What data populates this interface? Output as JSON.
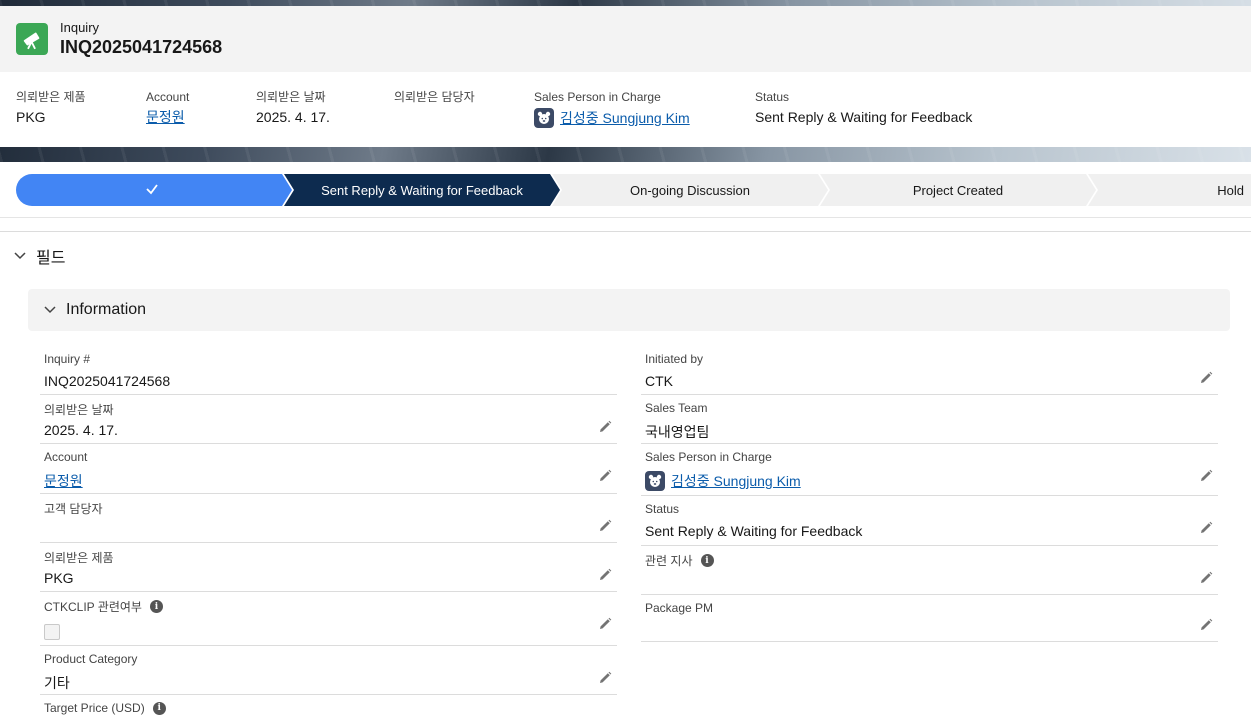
{
  "record": {
    "type_label": "Inquiry",
    "name": "INQ2025041724568",
    "icon": "telescope-icon",
    "icon_color": "#3ba755"
  },
  "highlights": [
    {
      "label": "의뢰받은 제품",
      "value": "PKG"
    },
    {
      "label": "Account",
      "value": "문정원"
    },
    {
      "label": "의뢰받은 날짜",
      "value": "2025. 4. 17."
    },
    {
      "label": "의뢰받은 담당자",
      "value": ""
    },
    {
      "label": "Sales Person in Charge",
      "value": "김성중 Sungjung Kim"
    },
    {
      "label": "Status",
      "value": "Sent Reply & Waiting for Feedback"
    }
  ],
  "path": {
    "steps": [
      {
        "label": "✓",
        "state": "complete"
      },
      {
        "label": "Sent Reply & Waiting for Feedback",
        "state": "current"
      },
      {
        "label": "On-going Discussion",
        "state": "incomplete"
      },
      {
        "label": "Project Created",
        "state": "incomplete"
      },
      {
        "label": "Hold",
        "state": "incomplete"
      }
    ],
    "colors": {
      "complete": "#4285f4",
      "current": "#0d2b4f",
      "incomplete": "#f0f0f0"
    }
  },
  "section": {
    "title": "필드",
    "subsection": "Information"
  },
  "left_fields": [
    {
      "label": "Inquiry #",
      "value": "INQ2025041724568"
    },
    {
      "label": "의뢰받은 날짜",
      "value": "2025. 4. 17."
    },
    {
      "label": "Account",
      "value": "문정원"
    },
    {
      "label": "고객 담당자",
      "value": ""
    },
    {
      "label": "의뢰받은 제품",
      "value": "PKG"
    },
    {
      "label": "CTKCLIP 관련여부",
      "value": ""
    },
    {
      "label": "Product Category",
      "value": "기타"
    },
    {
      "label": "Target Price (USD)",
      "value": ""
    }
  ],
  "right_fields": [
    {
      "label": "Initiated by",
      "value": "CTK"
    },
    {
      "label": "Sales Team",
      "value": "국내영업팀"
    },
    {
      "label": "Sales Person in Charge",
      "value": "김성중 Sungjung Kim"
    },
    {
      "label": "Status",
      "value": "Sent Reply & Waiting for Feedback"
    },
    {
      "label": "관련 지사",
      "value": ""
    },
    {
      "label": "Package PM",
      "value": ""
    }
  ]
}
